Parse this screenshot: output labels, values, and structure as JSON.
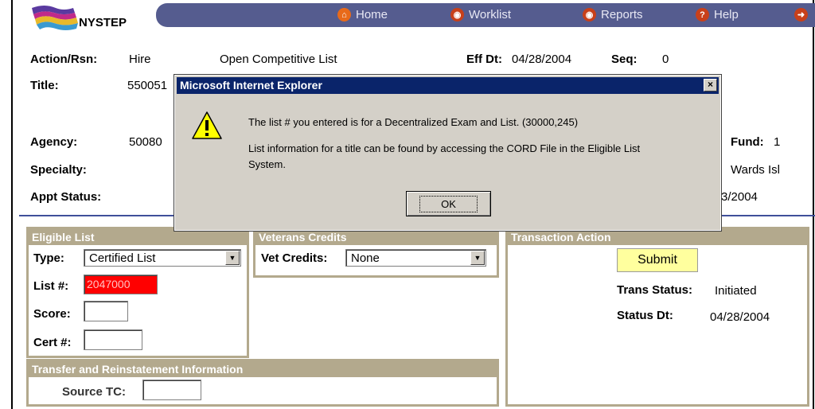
{
  "app": {
    "logo_text": "NYSTEP"
  },
  "nav": {
    "home": "Home",
    "worklist": "Worklist",
    "reports": "Reports",
    "help": "Help"
  },
  "header": {
    "action_label": "Action/Rsn:",
    "action_value": "Hire",
    "action_reason": "Open Competitive List",
    "effdt_label": "Eff Dt:",
    "effdt_value": "04/28/2004",
    "seq_label": "Seq:",
    "seq_value": "0",
    "title_label": "Title:",
    "title_value": "550051",
    "agency_label": "Agency:",
    "agency_value": "50080",
    "fund_label": "Fund:",
    "fund_value": "1",
    "specialty_label": "Specialty:",
    "location_value": "Wards Isl",
    "appt_label": "Appt Status:",
    "appt_date_partial": "3/2004"
  },
  "eligible": {
    "heading": "Eligible List",
    "type_label": "Type:",
    "type_value": "Certified List",
    "list_label": "List #:",
    "list_value": "2047000",
    "score_label": "Score:",
    "score_value": "",
    "cert_label": "Cert #:",
    "cert_value": ""
  },
  "veterans": {
    "heading": "Veterans Credits",
    "vet_label": "Vet Credits:",
    "vet_value": "None"
  },
  "transaction": {
    "heading": "Transaction Action",
    "submit_label": "Submit",
    "status_label": "Trans Status:",
    "status_value": "Initiated",
    "statusdt_label": "Status Dt:",
    "statusdt_value": "04/28/2004"
  },
  "transfer": {
    "heading": "Transfer and Reinstatement Information",
    "source_label": "Source TC:",
    "source_value": ""
  },
  "dialog": {
    "title": "Microsoft Internet Explorer",
    "close": "×",
    "line1": "The list # you entered is for a Decentralized Exam and List. (30000,245)",
    "line2": "List information for a title can be found by accessing the CORD File in the Eligible List",
    "line3": "System.",
    "ok_label": "OK"
  },
  "colors": {
    "navbar": "#555c8f",
    "panel_border": "#b3a98d",
    "list_highlight": "#ff0000",
    "submit_bg": "#ffff9e",
    "dialog_title": "#0a246a"
  }
}
